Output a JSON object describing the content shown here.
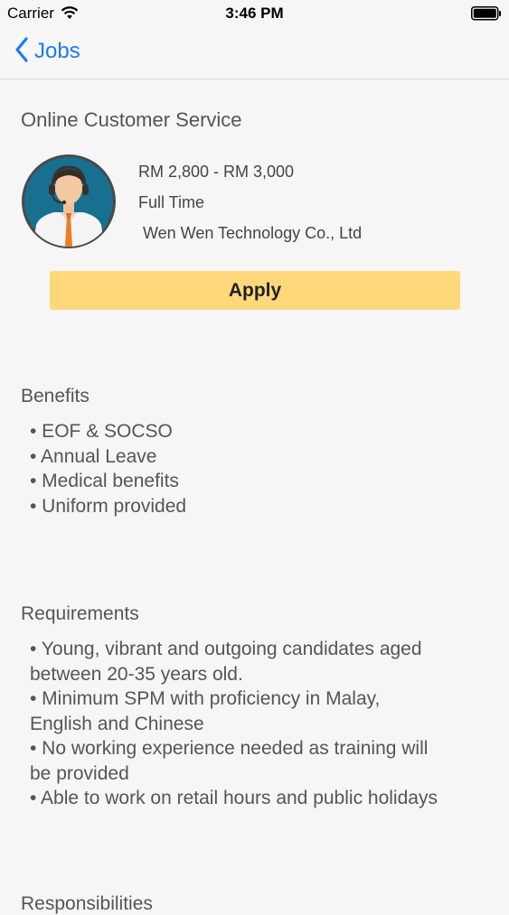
{
  "status_bar": {
    "carrier": "Carrier",
    "time": "3:46 PM",
    "wifi_icon": "wifi-icon",
    "battery_icon": "battery-icon"
  },
  "nav": {
    "back_label": "Jobs",
    "back_icon": "chevron-left-icon",
    "accent_color": "#1b7cf5"
  },
  "job": {
    "title": "Online Customer Service",
    "salary": "RM 2,800 - RM 3,000",
    "type": "Full Time",
    "company": "Wen Wen Technology Co., Ltd",
    "avatar_icon": "customer-service-agent-avatar",
    "apply_label": "Apply",
    "apply_color": "#ffd87c"
  },
  "benefits": {
    "heading": "Benefits",
    "items": [
      "• EOF & SOCSO",
      "• Annual Leave",
      "• Medical benefits",
      "• Uniform provided"
    ]
  },
  "requirements": {
    "heading": "Requirements",
    "lines": [
      "• Young, vibrant and outgoing candidates aged",
      "between 20-35 years old.",
      "• Minimum SPM with proficiency in Malay,",
      "English and Chinese",
      "• No working experience needed as training will",
      "be provided",
      "• Able to work on retail hours and public holidays"
    ]
  },
  "responsibilities": {
    "heading": "Responsibilities"
  }
}
